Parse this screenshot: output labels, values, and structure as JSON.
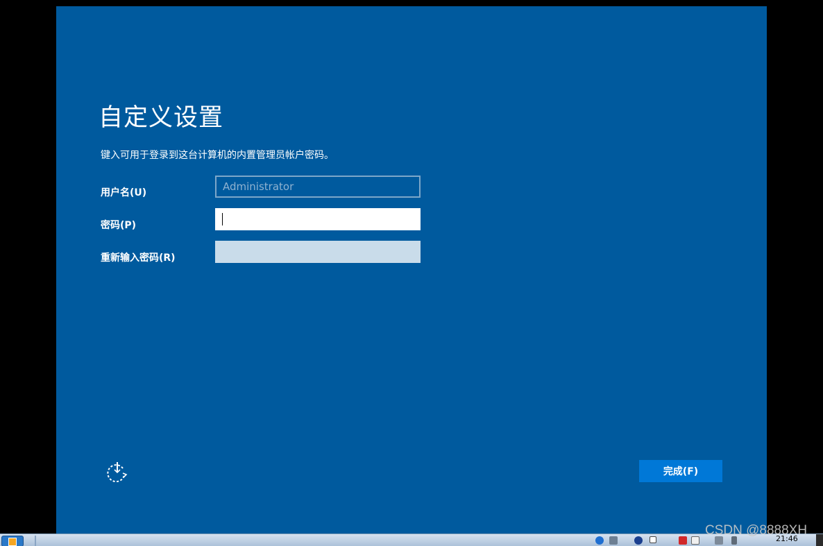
{
  "setup": {
    "title": "自定义设置",
    "description": "键入可用于登录到这台计算机的内置管理员帐户密码。",
    "fields": {
      "username": {
        "label": "用户名(U)",
        "value": "Administrator"
      },
      "password": {
        "label": "密码(P)",
        "value": ""
      },
      "reenter": {
        "label": "重新输入密码(R)",
        "value": ""
      }
    },
    "finish_label": "完成(F)",
    "accessibility_icon": "ease-of-access-icon"
  },
  "taskbar": {
    "clock": "21:46"
  },
  "watermark": "CSDN @8888XH",
  "colors": {
    "panel_background": "#005a9e",
    "finish_button": "#0078d7",
    "disabled_input": "#c9dcea"
  }
}
